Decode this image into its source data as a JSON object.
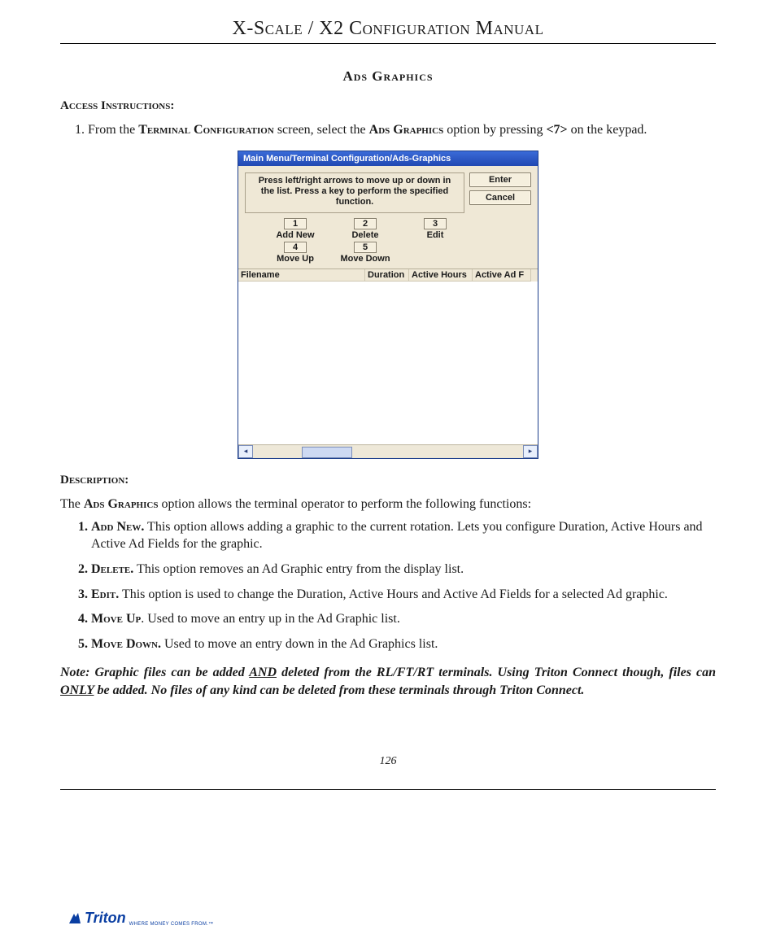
{
  "doc_title": "X-Scale / X2 Configuration Manual",
  "section_title": "Ads  Graphics",
  "access_heading": "Access Instructions:",
  "access_steps": [
    {
      "parts": [
        {
          "t": "From the "
        },
        {
          "t": "Terminal Configuration",
          "sc": true
        },
        {
          "t": " screen, select the "
        },
        {
          "t": "Ads Graphics",
          "sc": true
        },
        {
          "t": " option by pressing "
        },
        {
          "t": "<7>",
          "b": true
        },
        {
          "t": " on the keypad."
        }
      ]
    }
  ],
  "screenshot": {
    "title": "Main Menu/Terminal Configuration/Ads-Graphics",
    "instructions": "Press left/right arrows to move up or down in the list.  Press a key to perform the specified function.",
    "enter": "Enter",
    "cancel": "Cancel",
    "keys": [
      {
        "key": "1",
        "label": "Add New"
      },
      {
        "key": "2",
        "label": "Delete"
      },
      {
        "key": "3",
        "label": "Edit"
      },
      {
        "key": "4",
        "label": "Move Up"
      },
      {
        "key": "5",
        "label": "Move Down"
      }
    ],
    "columns": [
      "Filename",
      "Duration",
      "Active Hours",
      "Active Ad F"
    ]
  },
  "description_heading": "Description:",
  "description_intro_parts": [
    {
      "t": "The "
    },
    {
      "t": "Ads Graphics",
      "sc": true
    },
    {
      "t": " option allows the terminal operator to perform the following functions:"
    }
  ],
  "desc_items": [
    {
      "term": "Add New.",
      "text": "  This option allows adding a graphic to the current rotation. Lets you configure Duration, Active Hours and Active Ad Fields for the graphic."
    },
    {
      "term": "Delete.",
      "text": "  This option removes an Ad Graphic entry from the display list."
    },
    {
      "term": "Edit.",
      "text": "  This option is used to change the Duration, Active Hours and Active Ad Fields for a selected Ad graphic."
    },
    {
      "term": "Move Up",
      "text": ". Used to move an entry up in the Ad Graphic list."
    },
    {
      "term": "Move Down.",
      "text": "  Used to move an entry down in the Ad Graphics list."
    }
  ],
  "note_parts": [
    {
      "t": "Note:  Graphic files can be added "
    },
    {
      "t": " AND",
      "u": true
    },
    {
      "t": " deleted from the RL/FT/RT terminals. Using Triton Connect though, files can "
    },
    {
      "t": "ONLY",
      "u": true
    },
    {
      "t": " be added. No files of any kind can be deleted from these terminals through Triton Connect."
    }
  ],
  "page_number": "126",
  "logo": {
    "brand": "Triton",
    "tagline": "WHERE MONEY COMES FROM.™"
  }
}
